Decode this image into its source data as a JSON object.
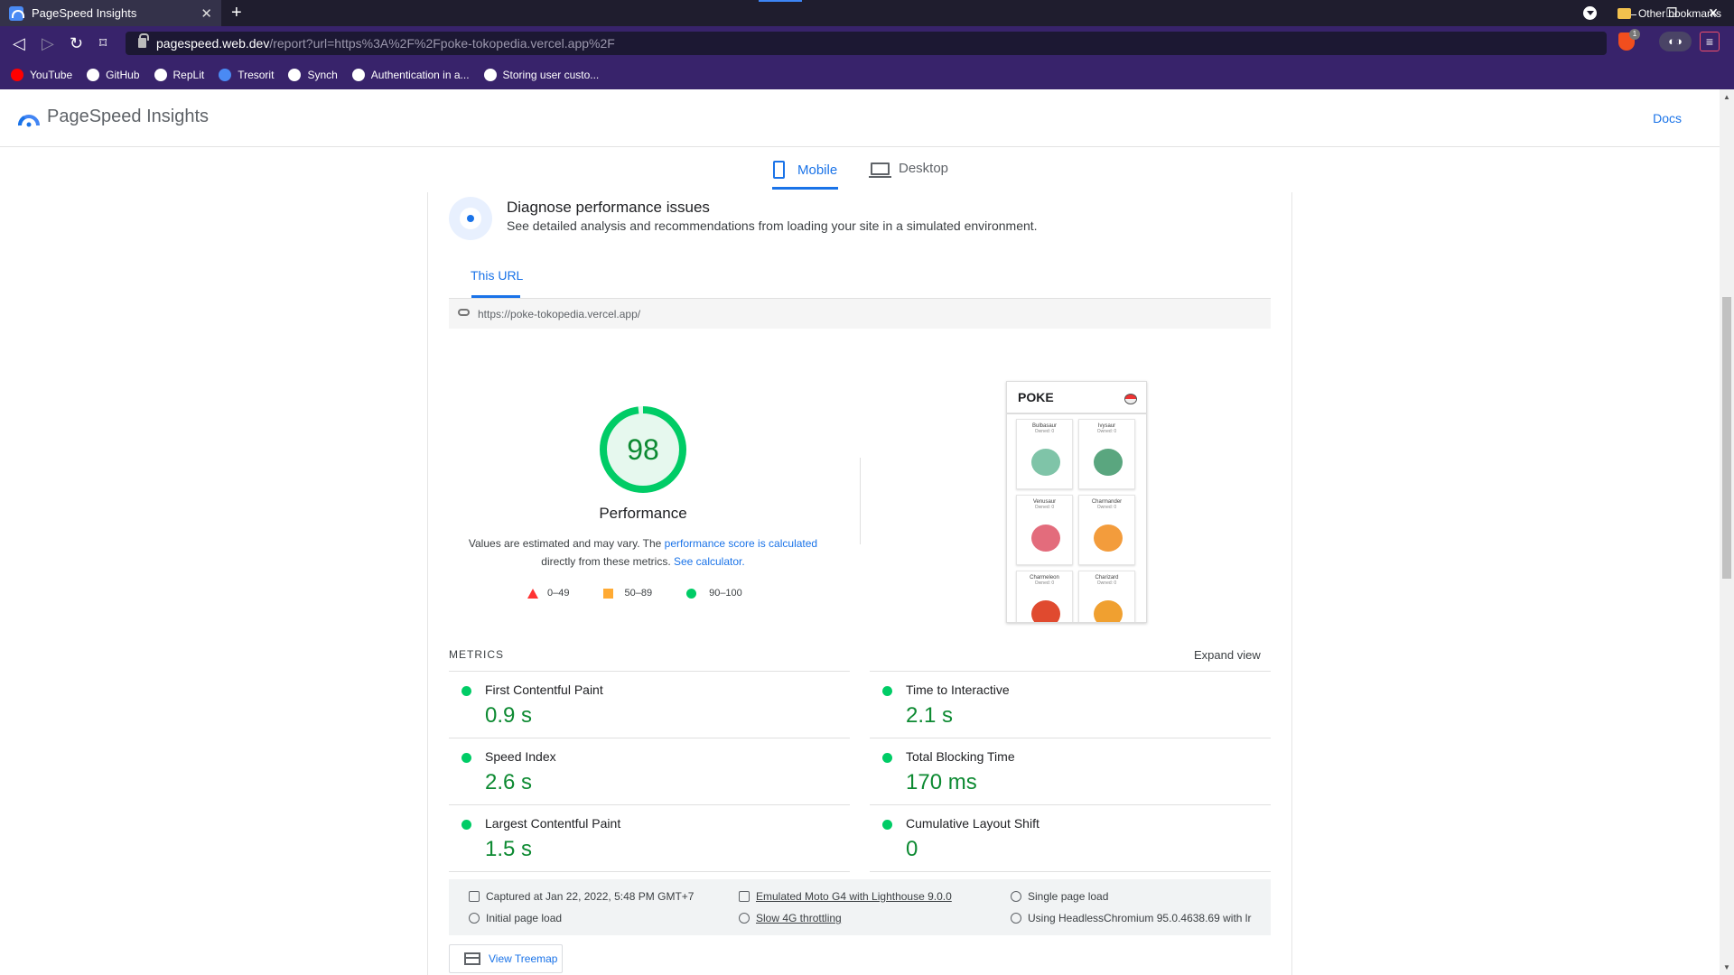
{
  "browser": {
    "tab_title": "PageSpeed Insights",
    "url_host": "pagespeed.web.dev",
    "url_path": "/report?url=https%3A%2F%2Fpoke-tokopedia.vercel.app%2F",
    "brave_badge": "1",
    "bookmarks": [
      {
        "label": "YouTube",
        "icon": "youtube-icon",
        "color": "#ff0000"
      },
      {
        "label": "GitHub",
        "icon": "github-icon",
        "color": "#ffffff"
      },
      {
        "label": "RepLit",
        "icon": "replit-icon",
        "color": "#ffffff"
      },
      {
        "label": "Tresorit",
        "icon": "tresorit-icon",
        "color": "#4a8af4"
      },
      {
        "label": "Synch",
        "icon": "synch-icon",
        "color": "#ffffff"
      },
      {
        "label": "Authentication in a...",
        "icon": "r-icon",
        "color": "#ffffff"
      },
      {
        "label": "Storing user custo...",
        "icon": "dev-icon",
        "color": "#ffffff"
      }
    ],
    "other_bookmarks": "Other bookmarks"
  },
  "header": {
    "title": "PageSpeed Insights",
    "docs": "Docs"
  },
  "device_tabs": {
    "mobile": "Mobile",
    "desktop": "Desktop",
    "selected": "Mobile"
  },
  "diagnose": {
    "title": "Diagnose performance issues",
    "subtitle": "See detailed analysis and recommendations from loading your site in a simulated environment.",
    "tab": "This URL",
    "url": "https://poke-tokopedia.vercel.app/"
  },
  "performance": {
    "score": "98",
    "score_value": 98,
    "label": "Performance",
    "note_pre": "Values are estimated and may vary. The ",
    "note_link1": "performance score is calculated",
    "note_mid": " directly from these metrics. ",
    "note_link2": "See calculator.",
    "legend": {
      "low": "0–49",
      "mid": "50–89",
      "high": "90–100"
    }
  },
  "screenshot": {
    "title": "POKE",
    "pokemon": [
      {
        "name": "Bulbasaur",
        "owned": "Owned: 0",
        "color": "#7fc4a8"
      },
      {
        "name": "Ivysaur",
        "owned": "Owned: 0",
        "color": "#5aa67f"
      },
      {
        "name": "Venusaur",
        "owned": "Owned: 0",
        "color": "#e36c7c"
      },
      {
        "name": "Charmander",
        "owned": "Owned: 0",
        "color": "#f39c3c"
      },
      {
        "name": "Charmeleon",
        "owned": "Owned: 0",
        "color": "#e04a2f"
      },
      {
        "name": "Charizard",
        "owned": "Owned: 0",
        "color": "#f0a030"
      }
    ]
  },
  "metrics": {
    "heading": "METRICS",
    "expand": "Expand view",
    "items": [
      {
        "label": "First Contentful Paint",
        "value": "0.9 s"
      },
      {
        "label": "Time to Interactive",
        "value": "2.1 s"
      },
      {
        "label": "Speed Index",
        "value": "2.6 s"
      },
      {
        "label": "Total Blocking Time",
        "value": "170 ms"
      },
      {
        "label": "Largest Contentful Paint",
        "value": "1.5 s"
      },
      {
        "label": "Cumulative Layout Shift",
        "value": "0"
      }
    ]
  },
  "info": {
    "captured": "Captured at Jan 22, 2022, 5:48 PM GMT+7",
    "initial": "Initial page load",
    "emulated": "Emulated Moto G4 with Lighthouse 9.0.0",
    "throttling": "Slow 4G throttling",
    "single": "Single page load",
    "headless": "Using HeadlessChromium 95.0.4638.69 with lr"
  },
  "treemap": "View Treemap"
}
